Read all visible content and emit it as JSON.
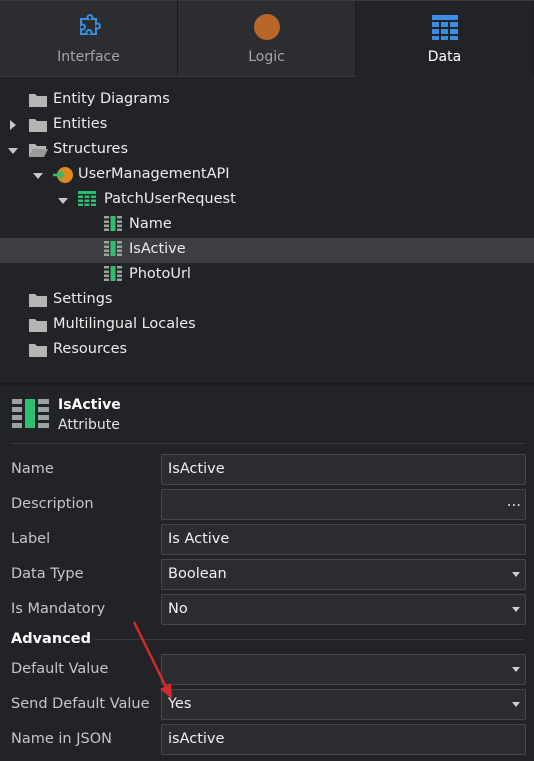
{
  "tabs": [
    {
      "label": "Interface",
      "icon": "puzzle-icon",
      "active": false
    },
    {
      "label": "Logic",
      "icon": "logic-circle-icon",
      "active": false
    },
    {
      "label": "Data",
      "icon": "data-grid-icon",
      "active": true
    }
  ],
  "tree": {
    "entity_diagrams": "Entity Diagrams",
    "entities": "Entities",
    "structures": "Structures",
    "api": "UserManagementAPI",
    "structure": "PatchUserRequest",
    "attr_name": "Name",
    "attr_isactive": "IsActive",
    "attr_photourl": "PhotoUrl",
    "settings": "Settings",
    "locales": "Multilingual Locales",
    "resources": "Resources"
  },
  "properties": {
    "title": "IsActive",
    "subtitle": "Attribute",
    "name": {
      "label": "Name",
      "value": "IsActive"
    },
    "description": {
      "label": "Description",
      "value": "",
      "button": "..."
    },
    "label_field": {
      "label": "Label",
      "value": "Is Active"
    },
    "data_type": {
      "label": "Data Type",
      "value": "Boolean"
    },
    "is_mandatory": {
      "label": "Is Mandatory",
      "value": "No"
    },
    "advanced": "Advanced",
    "default_value": {
      "label": "Default Value",
      "value": ""
    },
    "send_default": {
      "label": "Send Default Value",
      "value": "Yes"
    },
    "name_json": {
      "label": "Name in JSON",
      "value": "isActive"
    }
  },
  "colors": {
    "accent_green": "#2fbf71",
    "tab_blue": "#3a8fe0",
    "logic_orange": "#b8662a",
    "annotation_red": "#d42a2a"
  }
}
